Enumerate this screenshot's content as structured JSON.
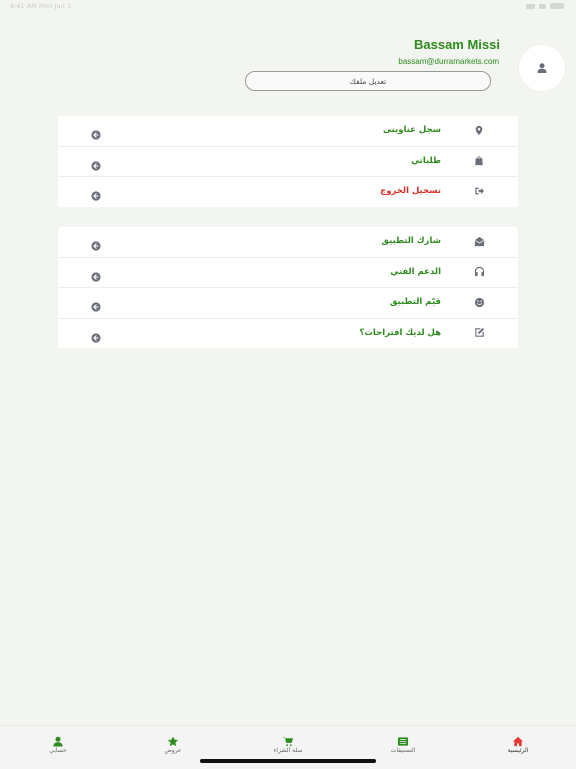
{
  "status_bar": {
    "time_date": "9:41 AM  Mon Jun 3"
  },
  "profile": {
    "name": "Bassam Missi",
    "email": "bassam@durramarkets.com",
    "edit_label": "تعديل ملفك"
  },
  "menu_group_1": [
    {
      "label": "سجل عناوينى",
      "icon": "location-pin-icon",
      "danger": false
    },
    {
      "label": "طلباتي",
      "icon": "shopping-bag-icon",
      "danger": false
    },
    {
      "label": "تسجيل الخروج",
      "icon": "logout-icon",
      "danger": true
    }
  ],
  "menu_group_2": [
    {
      "label": "شارك التطبيق",
      "icon": "envelope-open-icon",
      "danger": false
    },
    {
      "label": "الدعم الفني",
      "icon": "headphones-icon",
      "danger": false
    },
    {
      "label": "قيّم التطبيق",
      "icon": "smile-icon",
      "danger": false
    },
    {
      "label": "هل لديك اقتراحات؟",
      "icon": "edit-icon",
      "danger": false
    }
  ],
  "bottom_nav": [
    {
      "label": "الرئيسية",
      "icon": "home-icon",
      "color": "#e53935"
    },
    {
      "label": "التصنيفات",
      "icon": "categories-icon",
      "color": "#2e8b1e"
    },
    {
      "label": "سلة الشراء",
      "icon": "cart-icon",
      "color": "#2e8b1e"
    },
    {
      "label": "عروض",
      "icon": "star-icon",
      "color": "#2e8b1e"
    },
    {
      "label": "حسابي",
      "icon": "user-icon",
      "color": "#2e8b1e"
    }
  ],
  "colors": {
    "brand_green": "#2e8b1e",
    "danger_red": "#d93025",
    "home_red": "#e53935"
  }
}
